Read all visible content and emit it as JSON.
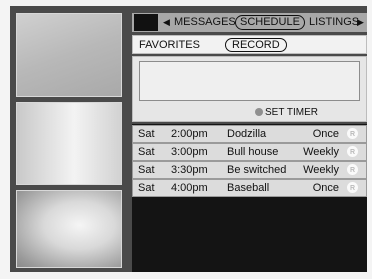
{
  "topbar": {
    "prev_arrow": "◀",
    "tab_messages": "MESSAGES",
    "tab_schedule": "SCHEDULE",
    "tab_listings": "LISTINGS",
    "next_arrow": "▶"
  },
  "subbar": {
    "favorites": "FAVORITES",
    "record": "RECORD"
  },
  "panel": {
    "set_timer": "SET TIMER"
  },
  "schedule": [
    {
      "day": "Sat",
      "time": "2:00pm",
      "title": "Dodzilla",
      "frequency": "Once",
      "badge": "R"
    },
    {
      "day": "Sat",
      "time": "3:00pm",
      "title": "Bull house",
      "frequency": "Weekly",
      "badge": "R"
    },
    {
      "day": "Sat",
      "time": "3:30pm",
      "title": "Be switched",
      "frequency": "Weekly",
      "badge": "R"
    },
    {
      "day": "Sat",
      "time": "4:00pm",
      "title": "Baseball",
      "frequency": "Once",
      "badge": "R"
    }
  ]
}
